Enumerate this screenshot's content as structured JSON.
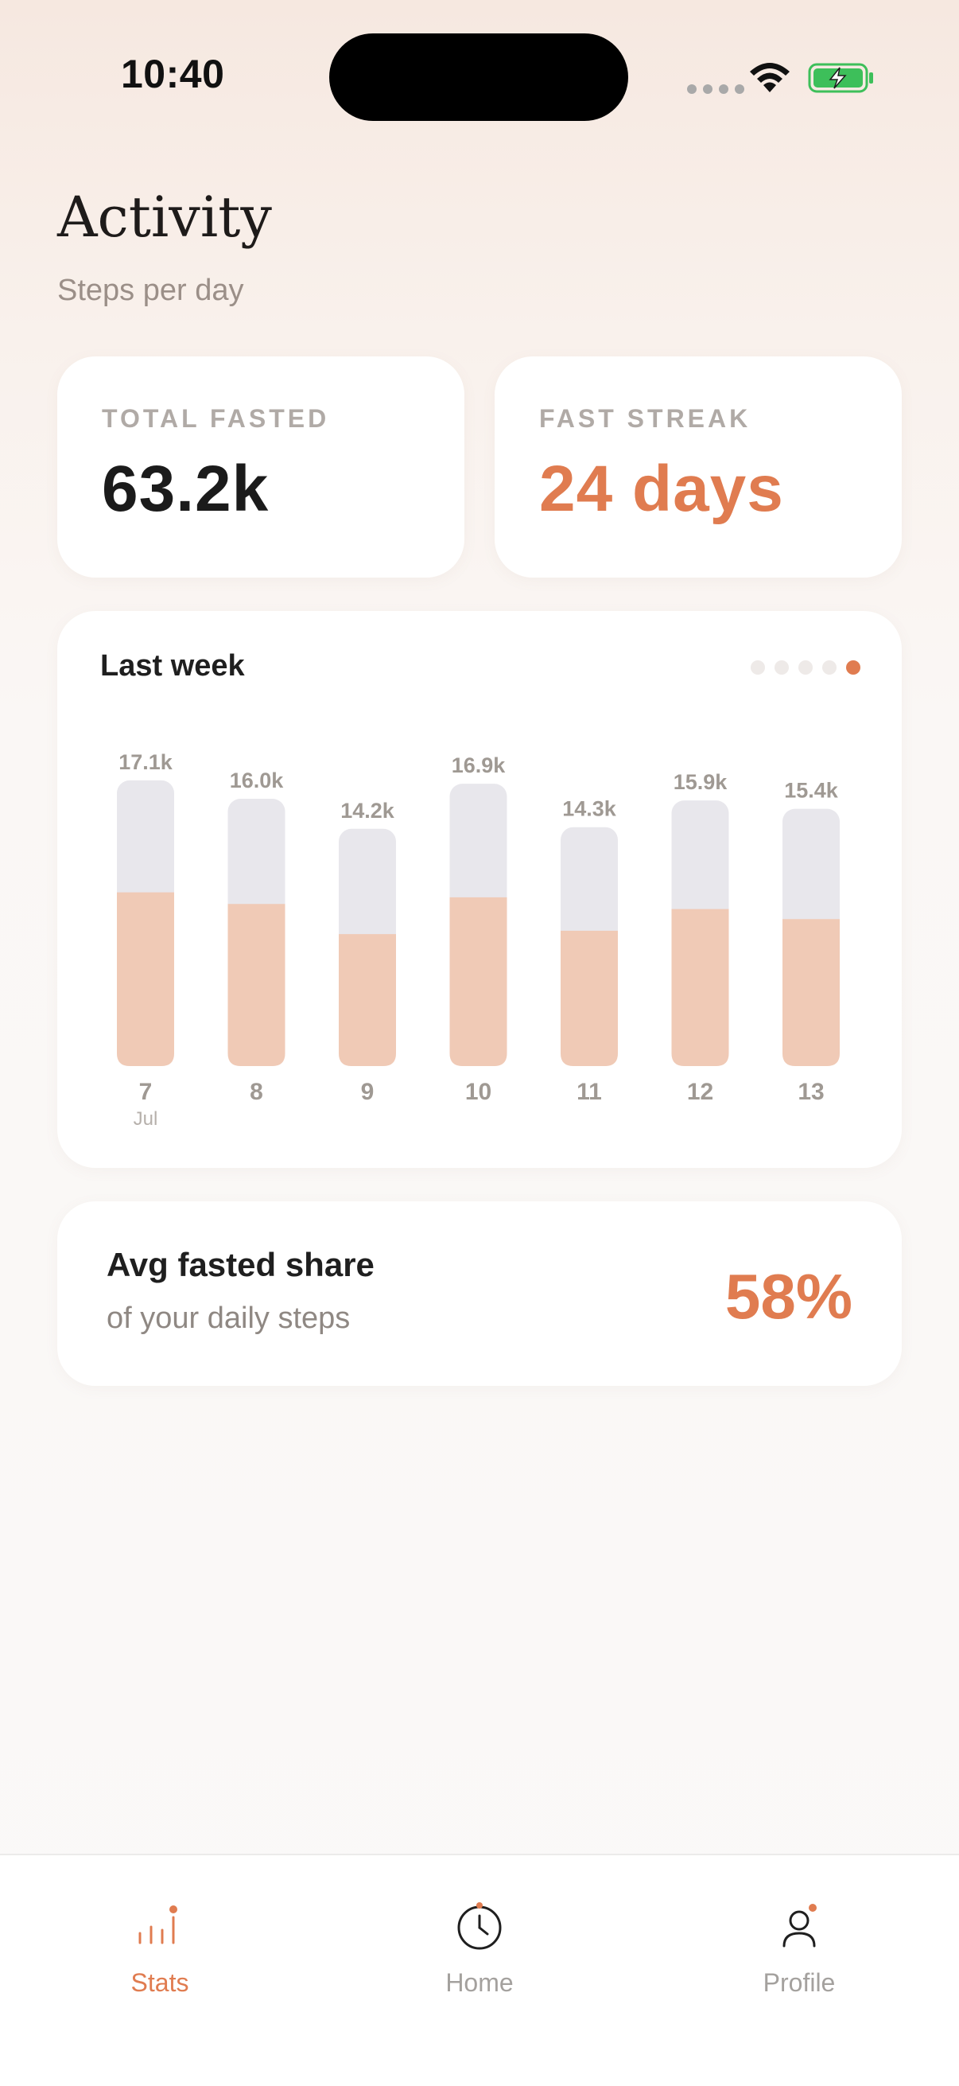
{
  "status_bar": {
    "time": "10:40"
  },
  "header": {
    "title": "Activity",
    "subtitle": "Steps per day"
  },
  "stats": {
    "total_fasted": {
      "label": "TOTAL FASTED",
      "value": "63.2k"
    },
    "fast_streak": {
      "label": "FAST STREAK",
      "value": "24 days"
    }
  },
  "chart_card": {
    "title": "Last week",
    "page_count": 5,
    "active_page": 4
  },
  "chart_data": {
    "type": "bar",
    "categories": [
      "7",
      "8",
      "9",
      "10",
      "11",
      "12",
      "13"
    ],
    "month_label": "Jul",
    "series": [
      {
        "name": "",
        "values": [
          17.1,
          16.0,
          14.2,
          16.9,
          14.3,
          15.9,
          15.4
        ]
      },
      {
        "name": "",
        "values": [
          10.4,
          9.7,
          7.9,
          10.1,
          8.1,
          9.4,
          8.8
        ]
      }
    ],
    "value_labels": [
      "17.1k",
      "16.0k",
      "14.2k",
      "16.9k",
      "14.3k",
      "15.9k",
      "15.4k"
    ],
    "unit": "k",
    "colors": {
      "total": "#e8e7ec",
      "fasted": "#f0cab6"
    }
  },
  "avg_card": {
    "title": "Avg fasted share",
    "subtitle": "of your daily steps",
    "value": "58%"
  },
  "tabs": [
    {
      "label": "Stats",
      "icon": "stats-icon",
      "active": true
    },
    {
      "label": "Home",
      "icon": "clock-icon",
      "active": false
    },
    {
      "label": "Profile",
      "icon": "profile-icon",
      "active": false
    }
  ],
  "colors": {
    "accent": "#e07c50",
    "text": "#1f1f1f",
    "muted": "#9f9993"
  }
}
